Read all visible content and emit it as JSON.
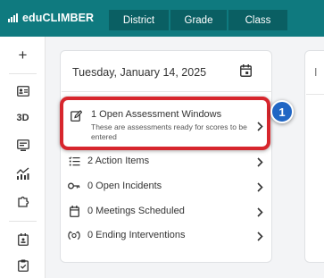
{
  "app": {
    "name": "eduCLIMBER"
  },
  "nav": {
    "tabs": [
      {
        "label": "District"
      },
      {
        "label": "Grade"
      },
      {
        "label": "Class"
      }
    ]
  },
  "sidebar": {
    "add_label": "+",
    "threed_label": "3D"
  },
  "card": {
    "date": "Tuesday, January 14, 2025",
    "assessment": {
      "title": "1 Open Assessment Windows",
      "description": "These are assessments ready for scores to be entered"
    },
    "items": [
      {
        "label": "2 Action Items",
        "icon": "list-icon"
      },
      {
        "label": "0 Open Incidents",
        "icon": "key-icon"
      },
      {
        "label": "0 Meetings Scheduled",
        "icon": "calendar-icon"
      },
      {
        "label": "0 Ending Interventions",
        "icon": "intervention-icon"
      }
    ]
  },
  "second_card": {
    "title_fragment": "I"
  },
  "callout": {
    "number": "1",
    "color": "#2166c4",
    "highlight_color": "#d7262d"
  },
  "colors": {
    "brand": "#0f7a7f",
    "tab": "#0a5f63"
  }
}
